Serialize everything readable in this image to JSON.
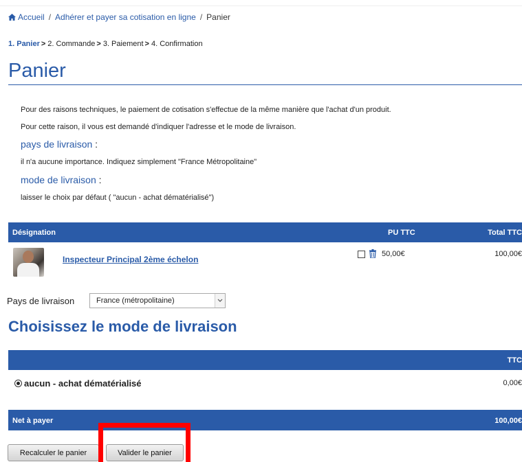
{
  "breadcrumb": {
    "home": "Accueil",
    "separator": "/",
    "middle": "Adhérer et payer sa cotisation en ligne",
    "current": "Panier"
  },
  "steps": {
    "step1": "1. Panier",
    "step2": "2. Commande",
    "step3": "3. Paiement",
    "step4": "4. Confirmation",
    "arrow": ">"
  },
  "page_title": "Panier",
  "info": {
    "line1": "Pour des raisons techniques, le paiement de cotisation s'effectue de la même manière que l'achat d'un produit.",
    "line2": "Pour cette raison, il vous est demandé d'indiquer l'adresse et le mode de livraison.",
    "country_heading": "pays de livraison",
    "country_text": "il n'a aucune importance. Indiquez simplement \"France Métropolitaine\"",
    "mode_heading": "mode de livraison",
    "mode_text": "laisser le choix par défaut ( \"aucun - achat dématérialisé\")",
    "colon": " :"
  },
  "cart_table": {
    "headers": {
      "designation": "Désignation",
      "unit_price": "PU TTC",
      "total": "Total TTC"
    },
    "row": {
      "product": "Inspecteur Principal 2ème échelon",
      "unit_price": "50,00€",
      "total": "100,00€",
      "icons": [
        "checkbox-icon",
        "trash-icon"
      ]
    }
  },
  "country": {
    "label": "Pays de livraison",
    "selected": "France (métropolitaine)"
  },
  "delivery": {
    "title": "Choisissez le mode de livraison",
    "header_ttc": "TTC",
    "option": "aucun - achat dématérialisé",
    "option_price": "0,00€"
  },
  "net": {
    "label": "Net à payer",
    "amount": "100,00€"
  },
  "buttons": {
    "recalc": "Recalculer le panier",
    "validate": "Valider le panier"
  },
  "colors": {
    "accent": "#2a5ba8",
    "highlight": "#ff0000"
  }
}
